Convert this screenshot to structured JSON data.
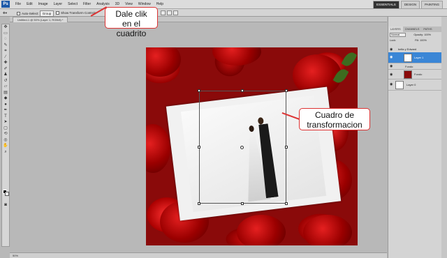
{
  "app": {
    "logo": "Ps"
  },
  "menu": [
    "File",
    "Edit",
    "Image",
    "Layer",
    "Select",
    "Filter",
    "Analysis",
    "3D",
    "View",
    "Window",
    "Help"
  ],
  "workspace": {
    "tabs": [
      "ESSENTIALS",
      "DESIGN",
      "PAINTING"
    ],
    "active": "ESSENTIALS"
  },
  "options": {
    "auto_select_label": "Auto-Select:",
    "auto_select_value": "Group",
    "show_transform_label": "Show Transform Controls"
  },
  "document": {
    "tab_title": "Untitled-1 @ 50% (Layer 1, RGB/8) *"
  },
  "callouts": {
    "top": "Dale clik en el cuadrito",
    "side": "Cuadro de transformacion"
  },
  "layers_panel": {
    "tabs": [
      "LAYERS",
      "CHANNELS",
      "PATHS"
    ],
    "blend_mode": "Normal",
    "opacity_label": "Opacity:",
    "opacity_value": "100%",
    "lock_label": "Lock:",
    "fill_label": "Fill:",
    "fill_value": "100%",
    "layers": [
      {
        "name": "bella y Edward",
        "kind": "group"
      },
      {
        "name": "Layer 1",
        "kind": "layer",
        "selected": true
      },
      {
        "name": "Fondo",
        "kind": "group"
      },
      {
        "name": "Fondo",
        "kind": "layer"
      },
      {
        "name": "Layer 0",
        "kind": "layer"
      }
    ]
  },
  "status": {
    "zoom": "50%"
  }
}
